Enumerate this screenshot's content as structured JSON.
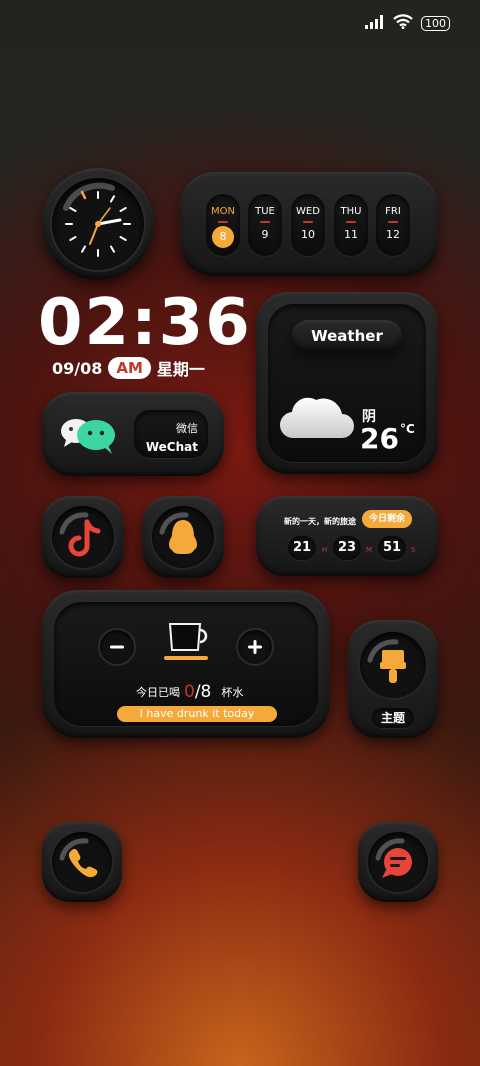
{
  "status_bar": {
    "signal_icon": "signal-icon",
    "wifi_icon": "wifi-icon",
    "battery_level": "100"
  },
  "calendar": {
    "days": [
      {
        "name": "MON",
        "date": "8",
        "active": true
      },
      {
        "name": "TUE",
        "date": "9"
      },
      {
        "name": "WED",
        "date": "10"
      },
      {
        "name": "THU",
        "date": "11"
      },
      {
        "name": "FRI",
        "date": "12"
      }
    ]
  },
  "clock": {
    "time": "02:36",
    "date": "09/08",
    "ampm": "AM",
    "weekday": "星期一"
  },
  "weather": {
    "title": "Weather",
    "condition": "阴",
    "temperature": "26",
    "unit": "°C"
  },
  "wechat": {
    "cn_label": "微信",
    "en_label": "WeChat"
  },
  "countdown": {
    "subtitle": "新的一天，新的旅途",
    "badge": "今日剩余",
    "hours": "21",
    "h_unit": "H",
    "minutes": "23",
    "m_unit": "M",
    "seconds": "51",
    "s_unit": "S"
  },
  "water": {
    "prefix": "今日已喝",
    "count": "0",
    "total": "/8",
    "suffix": "杯水",
    "button": "I have drunk it today"
  },
  "theme": {
    "label": "主题"
  },
  "colors": {
    "accent": "#f6a93b",
    "red": "#c0392b",
    "widget": "#1a1a1a"
  }
}
